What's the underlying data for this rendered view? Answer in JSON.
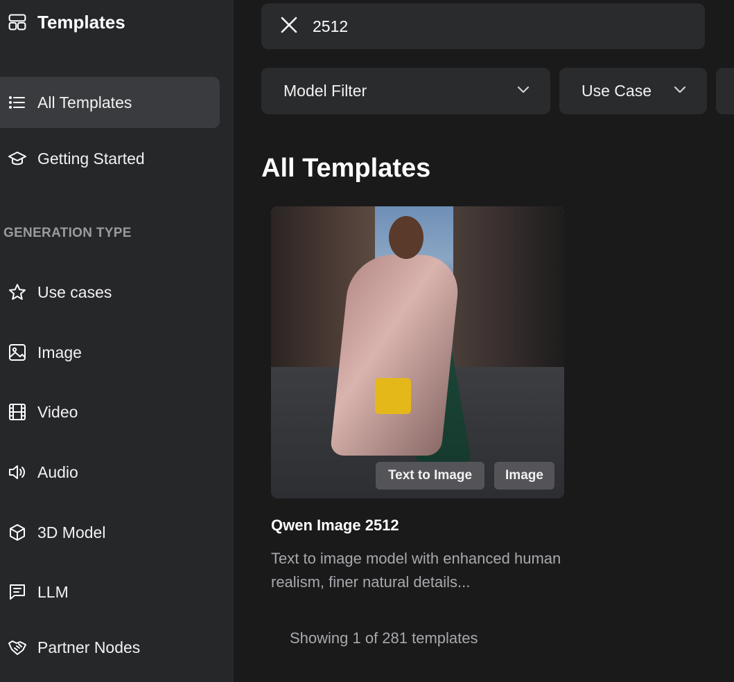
{
  "sidebar": {
    "brand_title": "Templates",
    "nav_top": [
      {
        "label": "All Templates",
        "icon": "list-icon",
        "active": true
      },
      {
        "label": "Getting Started",
        "icon": "graduation-cap-icon",
        "active": false
      }
    ],
    "section_label": "GENERATION TYPE",
    "nav_types": [
      {
        "label": "Use cases",
        "icon": "star-icon"
      },
      {
        "label": "Image",
        "icon": "image-icon"
      },
      {
        "label": "Video",
        "icon": "film-icon"
      },
      {
        "label": "Audio",
        "icon": "speaker-icon"
      },
      {
        "label": "3D Model",
        "icon": "cube-icon"
      },
      {
        "label": "LLM",
        "icon": "chat-icon"
      },
      {
        "label": "Partner Nodes",
        "icon": "handshake-icon"
      }
    ]
  },
  "search": {
    "value": "2512"
  },
  "filters": {
    "model_filter": "Model Filter",
    "use_case": "Use Case"
  },
  "main": {
    "page_title": "All Templates",
    "card": {
      "title": "Qwen Image 2512",
      "description": "Text to image model with enhanced human realism, finer natural details...",
      "tags": [
        "Text to Image",
        "Image"
      ]
    },
    "count_text": "Showing 1 of 281 templates"
  }
}
